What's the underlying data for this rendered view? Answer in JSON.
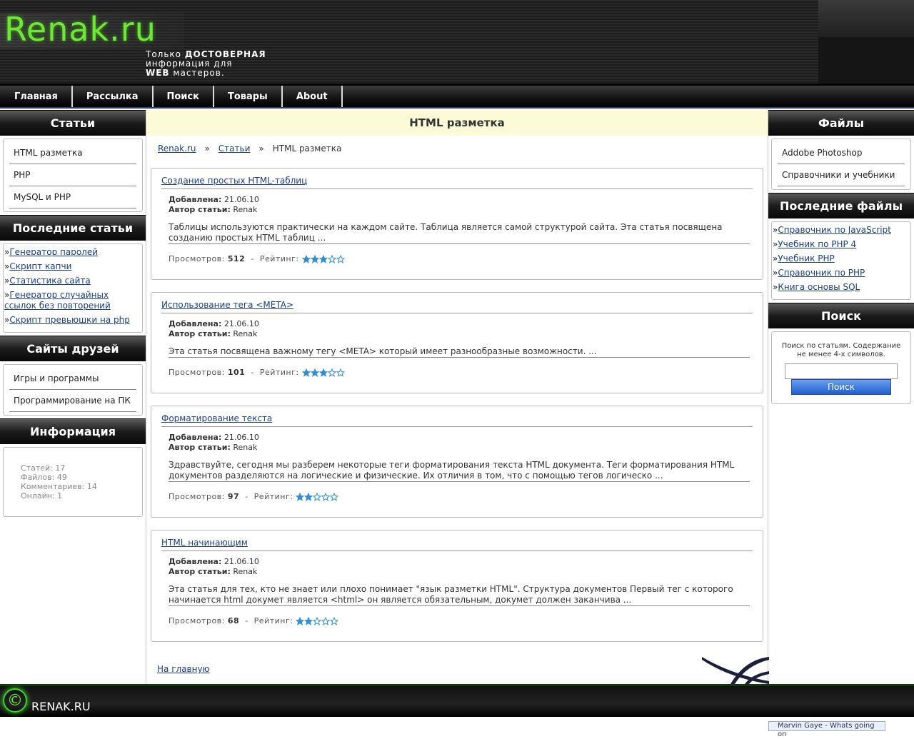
{
  "header": {
    "logo": "Renak.ru",
    "tagline_1": "Только ",
    "tagline_1b": "ДОСТОВЕРНАЯ",
    "tagline_2": "информация для",
    "tagline_3b": "WEB",
    "tagline_3": " мастеров."
  },
  "nav": [
    "Главная",
    "Рассылка",
    "Поиск",
    "Товары",
    "About"
  ],
  "left": {
    "articles_title": "Статьи",
    "articles": [
      "HTML разметка",
      "PHP",
      "MySQL и PHP"
    ],
    "latest_title": "Последние статьи",
    "latest": [
      "Генератор паролей",
      "Скрипт капчи",
      "Статистика сайта",
      "Генератор случайных ссылок без повторений",
      "Скрипт превьюшки на php"
    ],
    "friends_title": "Сайты друзей",
    "friends": [
      "Игры и программы",
      "Программирование на ПК"
    ],
    "info_title": "Информация",
    "info": [
      "Статей: 17",
      "Файлов: 49",
      "Комментариев: 14",
      "Онлайн: 1"
    ]
  },
  "right": {
    "files_title": "Файлы",
    "files": [
      "Addobe Photoshop",
      "Справочники и учебники"
    ],
    "latest_files_title": "Последние файлы",
    "latest_files": [
      "Справочник по JavaScript",
      "Учебник по PHP 4",
      "Учебник PHP",
      "Справочник по PHP",
      "Книга основы SQL"
    ],
    "search_title": "Поиск",
    "search_hint": "Поиск по статьям. Содержание не менее 4-х символов.",
    "search_button": "Поиск"
  },
  "main": {
    "title": "HTML разметка",
    "breadcrumb": [
      "Renak.ru",
      "Статьи",
      "HTML разметка"
    ],
    "breadcrumb_sep": "»",
    "added_label": "Добавлена:",
    "author_label": "Автор статьи:",
    "views_label": "Просмотров:",
    "rating_label": "Рейтинг:",
    "articles": [
      {
        "title": "Создание простых HTML-таблиц",
        "date": "21.06.10",
        "author": "Renak",
        "text": "Таблицы используются практически на каждом сайте. Таблица является самой структурой сайта. Эта статья посвящена созданию простых HTML таблиц ...",
        "views": "512",
        "rating": 3
      },
      {
        "title": "Использование тега <META>",
        "date": "21.06.10",
        "author": "Renak",
        "text": "Эта статья посвящена важному тегу <META> который имеет разнообразные возможности. ...",
        "views": "101",
        "rating": 3
      },
      {
        "title": "Форматирование текста",
        "date": "21.06.10",
        "author": "Renak",
        "text": "Здравствуйте, сегодня мы разберем некоторые теги форматирования текста HTML документа. Теги форматирования HTML документов разделяются на логические и физические. Их отличия в том, что с помощью тегов логическо ...",
        "views": "97",
        "rating": 2
      },
      {
        "title": "HTML начинающим",
        "date": "21.06.10",
        "author": "Renak",
        "text": "Эта статья для тех, кто не знает или плохо понимает \"язык разметки HTML\". Структура документов Первый тег с которого начинается html докумет является <html> он является обязательным, докумет должен заканчива ...",
        "views": "68",
        "rating": 2
      }
    ],
    "home_link": "На главную"
  },
  "footer": {
    "text": "RENAK.RU",
    "copyright": "©"
  },
  "popup": "Marvin Gaye - Whats going on"
}
